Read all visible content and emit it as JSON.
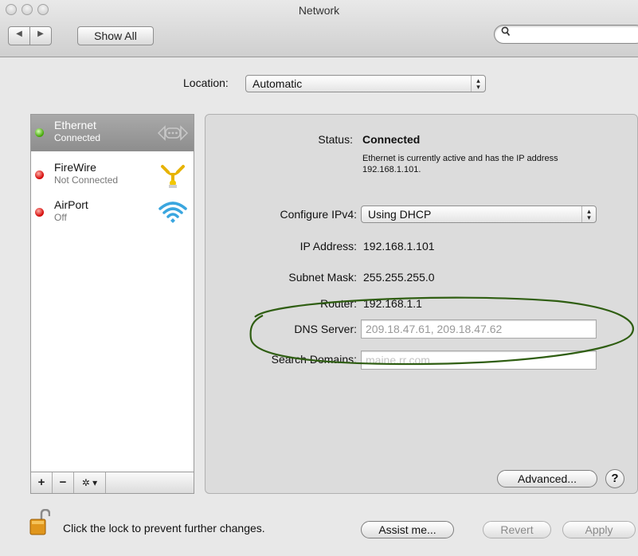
{
  "window": {
    "title": "Network"
  },
  "toolbar": {
    "back_icon": "back-arrow-icon",
    "forward_icon": "forward-arrow-icon",
    "show_all_label": "Show All",
    "search_placeholder": "",
    "search_icon": "magnifier-icon"
  },
  "location": {
    "label": "Location:",
    "value": "Automatic"
  },
  "services": [
    {
      "name": "Ethernet",
      "status": "Connected",
      "status_color": "#3fa300",
      "icon": "ethernet-icon",
      "selected": true
    },
    {
      "name": "FireWire",
      "status": "Not Connected",
      "status_color": "#d20000",
      "icon": "firewire-icon",
      "selected": false
    },
    {
      "name": "AirPort",
      "status": "Off",
      "status_color": "#d20000",
      "icon": "airport-wifi-icon",
      "selected": false
    }
  ],
  "list_toolbar": {
    "add": "+",
    "remove": "−",
    "action": "✲ ▾"
  },
  "details": {
    "status_label": "Status:",
    "status_value": "Connected",
    "status_description": "Ethernet is currently active and has the IP address 192.168.1.101.",
    "configure_label": "Configure IPv4:",
    "configure_value": "Using DHCP",
    "ip_label": "IP Address:",
    "ip_value": "192.168.1.101",
    "subnet_label": "Subnet Mask:",
    "subnet_value": "255.255.255.0",
    "router_label": "Router:",
    "router_value": "192.168.1.1",
    "dns_label": "DNS Server:",
    "dns_value": "209.18.47.61, 209.18.47.62",
    "search_domains_label": "Search Domains:",
    "search_domains_value": "maine.rr.com",
    "advanced_label": "Advanced...",
    "help_label": "?"
  },
  "footer": {
    "lock_text": "Click the lock to prevent further changes.",
    "assist_label": "Assist me...",
    "revert_label": "Revert",
    "apply_label": "Apply"
  },
  "colors": {
    "annotation_ellipse": "#2f5e12",
    "selected_row": "#9b9b9b"
  }
}
